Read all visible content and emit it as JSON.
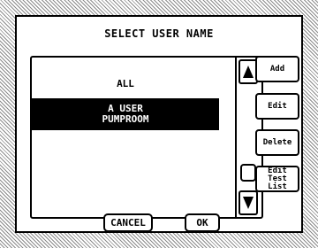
{
  "dialog": {
    "title": "SELECT USER NAME",
    "list": {
      "items": [
        {
          "label": "ALL"
        },
        {
          "lines": [
            "A USER",
            "PUMPROOM"
          ],
          "selected": true
        }
      ]
    },
    "side_buttons": {
      "add": "Add",
      "edit": "Edit",
      "delete": "Delete",
      "edit_test_list": [
        "Edit",
        "Test",
        "List"
      ]
    },
    "bottom_buttons": {
      "cancel": "CANCEL",
      "ok": "OK"
    },
    "icons": {
      "scroll_up": "up-triangle-icon",
      "scroll_down": "down-triangle-icon"
    },
    "colors": {
      "selection_background": "#000000",
      "selection_text": "#ffffff"
    }
  }
}
